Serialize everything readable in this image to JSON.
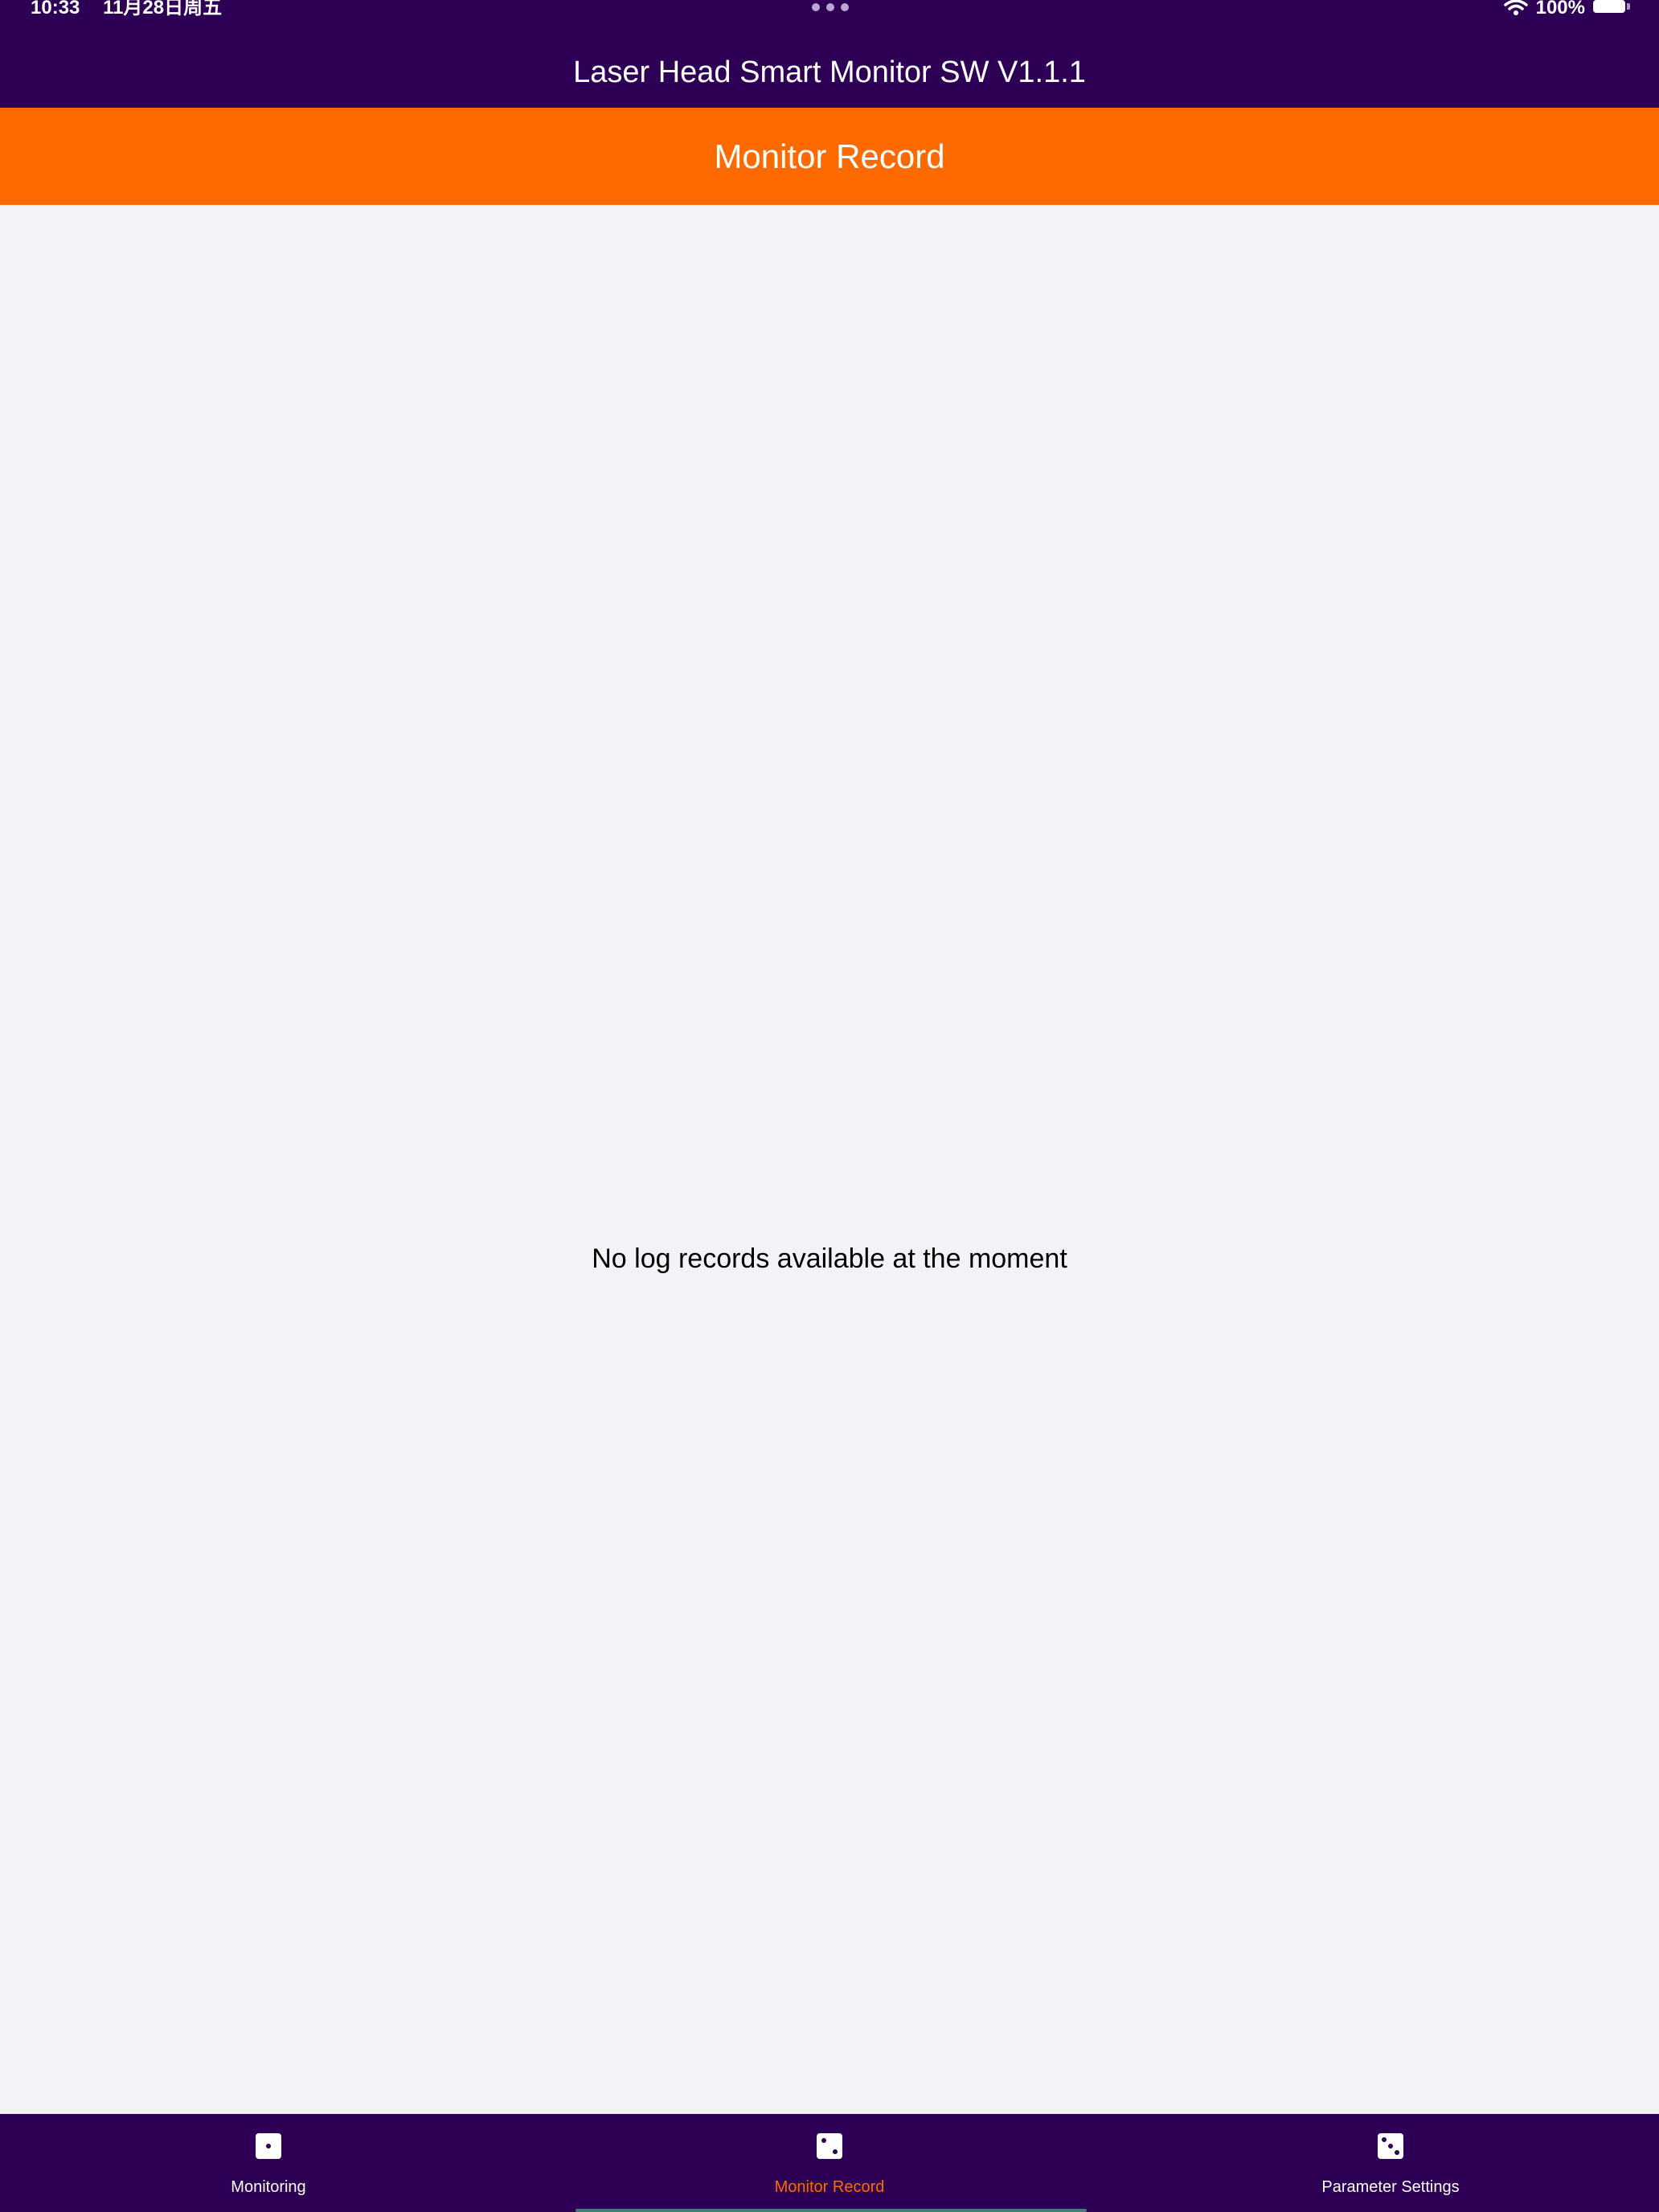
{
  "status_bar": {
    "time": "10:33",
    "date": "11月28日周五",
    "battery": "100%",
    "icons": [
      "wifi-icon",
      "battery-icon"
    ]
  },
  "app": {
    "title": "Laser Head Smart Monitor SW V1.1.1"
  },
  "page": {
    "title": "Monitor Record",
    "empty_message": "No log records available at the moment"
  },
  "tab_bar": {
    "tabs": [
      {
        "label": "Monitoring",
        "icon": "monitoring-icon",
        "active": false
      },
      {
        "label": "Monitor Record",
        "icon": "monitor-record-icon",
        "active": true
      },
      {
        "label": "Parameter Settings",
        "icon": "parameter-settings-icon",
        "active": false
      }
    ]
  },
  "colors": {
    "header_bg": "#2d0055",
    "accent": "#ff6a00",
    "content_bg": "#f2f3f7",
    "text": "#000000",
    "inverse_text": "#ffffff"
  }
}
